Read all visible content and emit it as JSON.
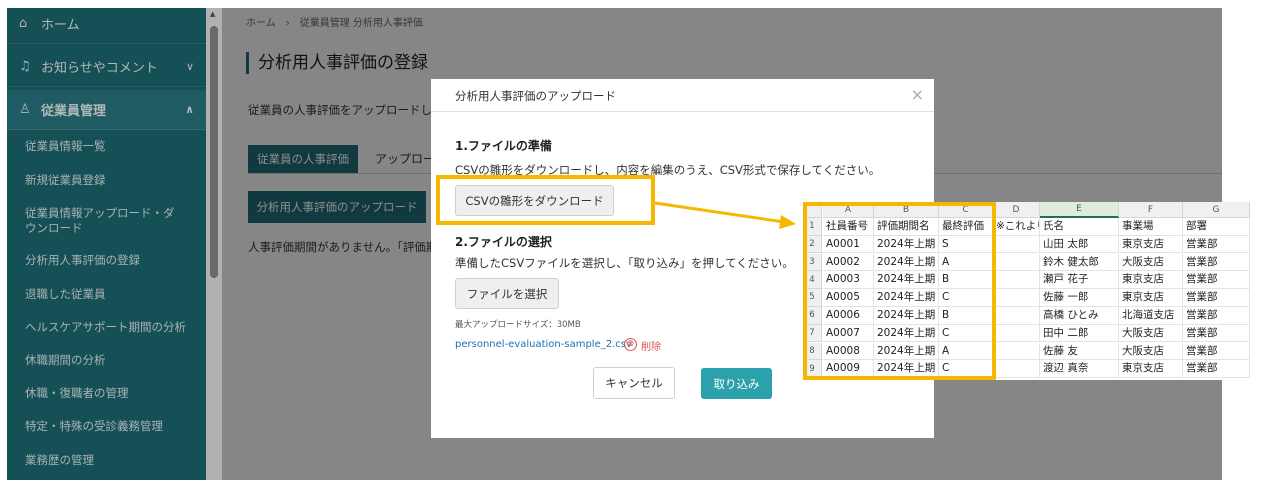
{
  "sidebar": {
    "top_items": [
      {
        "label": "ホーム",
        "icon": "home-icon"
      },
      {
        "label": "お知らせやコメント",
        "icon": "bell-icon"
      },
      {
        "label": "従業員管理",
        "icon": "users-icon"
      }
    ],
    "sub_items": [
      "従業員情報一覧",
      "新規従業員登録",
      "従業員情報アップロード・ダウンロード",
      "分析用人事評価の登録",
      "退職した従業員",
      "ヘルスケアサポート期間の分析",
      "休職期間の分析",
      "休職・復職者の管理",
      "特定・特殊の受診義務管理",
      "業務歴の管理"
    ]
  },
  "main": {
    "breadcrumb": "ホーム　›　従業員管理 分析用人事評価",
    "title": "分析用人事評価の登録",
    "description": "従業員の人事評価をアップロードし、",
    "tabs": [
      "従業員の人事評価",
      "アップロー"
    ],
    "upload_button": "分析用人事評価のアップロード",
    "empty_message": "人事評価期間がありません。「評価期"
  },
  "modal": {
    "title": "分析用人事評価のアップロード",
    "close": "×",
    "section1_heading": "1.ファイルの準備",
    "section1_text": "CSVの雛形をダウンロードし、内容を編集のうえ、CSV形式で保存してください。",
    "download_button": "CSVの雛形をダウンロード",
    "section2_heading": "2.ファイルの選択",
    "section2_text": "準備したCSVファイルを選択し、「取り込み」を押してください。",
    "choose_file_button": "ファイルを選択",
    "max_size": "最大アップロードサイズ：30MB",
    "file_name": "personnel-evaluation-sample_2.csv",
    "delete_icon": "⊗",
    "delete_label": "削除",
    "cancel_button": "キャンセル",
    "import_button": "取り込み"
  },
  "sheet": {
    "columns": [
      "A",
      "B",
      "C",
      "D",
      "E",
      "F",
      "G"
    ],
    "rows": [
      [
        "社員番号",
        "評価期間名",
        "最終評価",
        "※これより",
        "氏名",
        "事業場",
        "部署"
      ],
      [
        "A0001",
        "2024年上期",
        "S",
        "",
        "山田 太郎",
        "東京支店",
        "営業部"
      ],
      [
        "A0002",
        "2024年上期",
        "A",
        "",
        "鈴木 健太郎",
        "大阪支店",
        "営業部"
      ],
      [
        "A0003",
        "2024年上期",
        "B",
        "",
        "瀬戸 花子",
        "東京支店",
        "営業部"
      ],
      [
        "A0005",
        "2024年上期",
        "C",
        "",
        "佐藤 一郎",
        "東京支店",
        "営業部"
      ],
      [
        "A0006",
        "2024年上期",
        "B",
        "",
        "高橋 ひとみ",
        "北海道支店",
        "営業部"
      ],
      [
        "A0007",
        "2024年上期",
        "C",
        "",
        "田中 二郎",
        "大阪支店",
        "営業部"
      ],
      [
        "A0008",
        "2024年上期",
        "A",
        "",
        "佐藤 友",
        "大阪支店",
        "営業部"
      ],
      [
        "A0009",
        "2024年上期",
        "C",
        "",
        "渡辺 真奈",
        "東京支店",
        "営業部"
      ]
    ]
  },
  "colors": {
    "highlight": "#f5b800",
    "accent": "#1e6b74",
    "primary_button": "#2aa1ab"
  }
}
